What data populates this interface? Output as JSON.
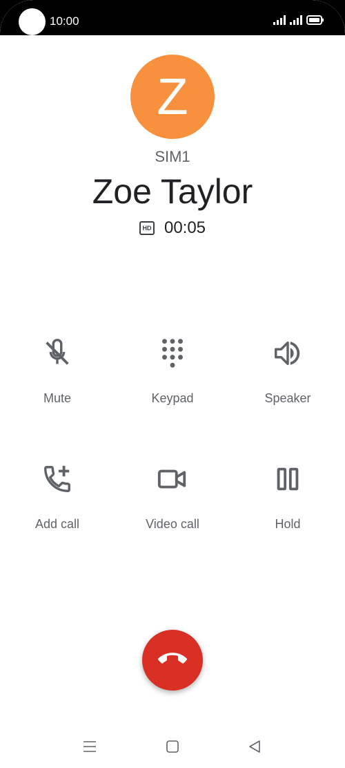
{
  "status_bar": {
    "time": "10:00",
    "icons": [
      "signal-icon",
      "signal-icon",
      "battery-icon"
    ]
  },
  "call": {
    "avatar_letter": "Z",
    "avatar_color": "#f7913e",
    "sim": "SIM1",
    "name": "Zoe Taylor",
    "hd_badge": "HD",
    "duration": "00:05"
  },
  "controls": [
    {
      "label": "Mute",
      "icon": "mic-off-icon"
    },
    {
      "label": "Keypad",
      "icon": "dialpad-icon"
    },
    {
      "label": "Speaker",
      "icon": "speaker-icon"
    },
    {
      "label": "Add call",
      "icon": "add-call-icon"
    },
    {
      "label": "Video call",
      "icon": "videocam-icon"
    },
    {
      "label": "Hold",
      "icon": "pause-icon"
    }
  ],
  "end_call": {
    "icon": "end-call-icon",
    "color": "#d93025"
  },
  "nav": {
    "icons": [
      "menu-icon",
      "home-icon",
      "back-icon"
    ]
  }
}
